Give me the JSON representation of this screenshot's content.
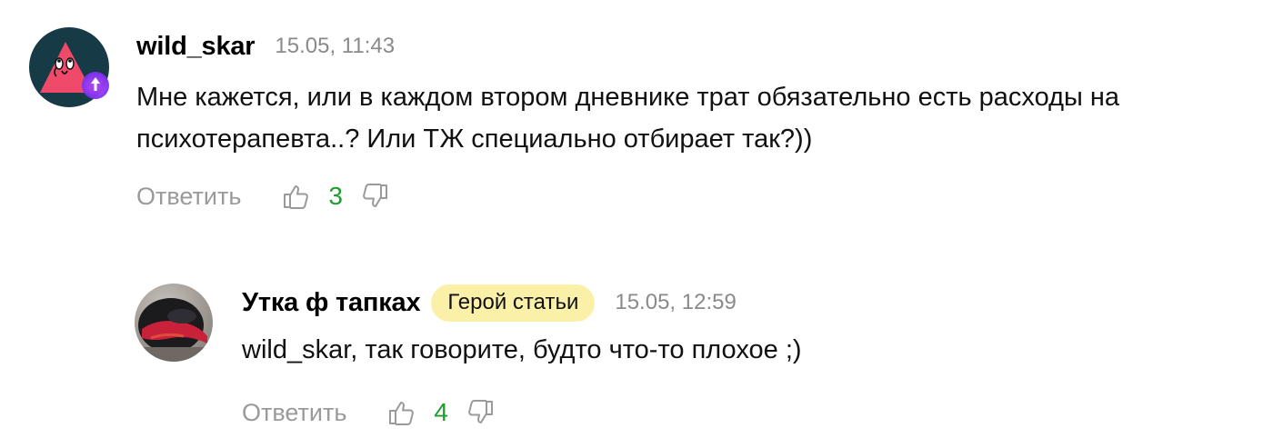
{
  "comments": [
    {
      "author": "wild_skar",
      "time": "15.05, 11:43",
      "text": "Мне кажется, или в каждом втором дневнике трат обязательно есть расходы на психотерапевта..? Или ТЖ специально отбирает так?))",
      "reply_label": "Ответить",
      "score": "3",
      "avatar_icon": "triangle-avatar-icon",
      "avatar_badge_icon": "upgrade-badge-icon",
      "score_color": "#1f9e2d"
    },
    {
      "author": "Утка ф тапках",
      "badge": "Герой статьи",
      "time": "15.05, 12:59",
      "text": "wild_skar, так говорите, будто что-то плохое ;)",
      "reply_label": "Ответить",
      "score": "4",
      "avatar_icon": "helmet-photo-avatar",
      "score_color": "#1f9e2d"
    }
  ],
  "colors": {
    "badge_bg": "#fbf0a8",
    "muted": "#9a9a9a",
    "positive": "#1f9e2d"
  }
}
